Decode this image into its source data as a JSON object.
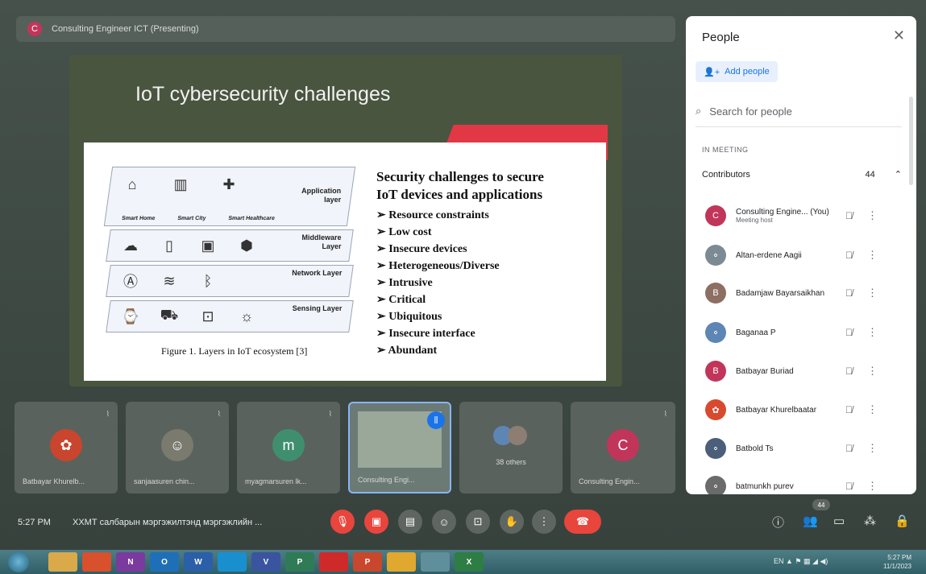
{
  "presenter": {
    "avatar_letter": "C",
    "label": "Consulting Engineer ICT (Presenting)"
  },
  "slide": {
    "title": "IoT cybersecurity challenges",
    "layers": [
      {
        "name": "Application layer"
      },
      {
        "name": "Middleware Layer"
      },
      {
        "name": "Network Layer"
      },
      {
        "name": "Sensing Layer"
      }
    ],
    "app_labels": [
      "Smart Home",
      "Smart City",
      "Smart Healthcare"
    ],
    "caption": "Figure 1. Layers in IoT ecosystem [3]",
    "heading_line1": "Security challenges to secure",
    "heading_line2": "IoT devices and applications",
    "bullets": [
      "Resource constraints",
      "Low cost",
      "Insecure devices",
      "Heterogeneous/Diverse",
      "Intrusive",
      "Critical",
      "Ubiquitous",
      "Insecure interface",
      "Abundant"
    ]
  },
  "tiles": [
    {
      "name": "Batbayar Khurelb...",
      "avatar": ""
    },
    {
      "name": "sanjaasuren chin...",
      "avatar": ""
    },
    {
      "name": "myagmarsuren lk...",
      "avatar": "m"
    },
    {
      "name": "Consulting Engi...",
      "avatar": ""
    },
    {
      "name": "",
      "avatar": "",
      "others": "38 others"
    },
    {
      "name": "Consulting Engin...",
      "avatar": "C"
    }
  ],
  "people_panel": {
    "title": "People",
    "add_people": "Add people",
    "search_placeholder": "Search for people",
    "in_meeting": "IN MEETING",
    "contributors_label": "Contributors",
    "contributors_count": "44",
    "people": [
      {
        "name": "Consulting Engine... (You)",
        "sub": "Meeting host",
        "avatar": "C",
        "color": "#c2355a"
      },
      {
        "name": "Altan-erdene Aagii",
        "sub": "",
        "avatar": "",
        "color": "#7c8b93"
      },
      {
        "name": "Badamjaw Bayarsaikhan",
        "sub": "",
        "avatar": "B",
        "color": "#8d6e63"
      },
      {
        "name": "Baganaa P",
        "sub": "",
        "avatar": "",
        "color": "#5e86b5"
      },
      {
        "name": "Batbayar Buriad",
        "sub": "",
        "avatar": "B",
        "color": "#c2355a"
      },
      {
        "name": "Batbayar Khurelbaatar",
        "sub": "",
        "avatar": "",
        "color": "#d84a2f"
      },
      {
        "name": "Batbold Ts",
        "sub": "",
        "avatar": "",
        "color": "#4b5f7a"
      },
      {
        "name": "batmunkh purev",
        "sub": "",
        "avatar": "",
        "color": "#6b6b6b"
      }
    ]
  },
  "bottom_bar": {
    "time": "5:27 PM",
    "meeting_name": "ХХМТ салбарын мэргэжилтэнд мэргэжлийн ...",
    "people_badge": "44"
  },
  "taskbar": {
    "apps": [
      "",
      "",
      "N",
      "O",
      "W",
      "",
      "V",
      "P",
      "",
      "P",
      "",
      "",
      "X"
    ],
    "tray_time": "5:27 PM",
    "tray_date": "11/1/2023",
    "tray_lang": "EN"
  }
}
